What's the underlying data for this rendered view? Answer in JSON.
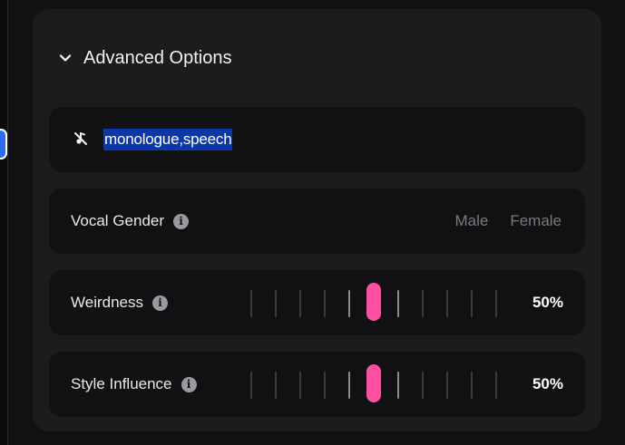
{
  "advanced": {
    "header_label": "Advanced Options",
    "chevron_icon": "chevron-down-icon"
  },
  "exclude": {
    "icon": "music-off-icon",
    "value": "monologue,speech"
  },
  "vocal_gender": {
    "label": "Vocal Gender",
    "options": [
      "Male",
      "Female"
    ]
  },
  "weirdness": {
    "label": "Weirdness",
    "value_text": "50%",
    "value": 0.5
  },
  "style_influence": {
    "label": "Style Influence",
    "value_text": "50%",
    "value": 0.5
  },
  "colors": {
    "accent": "#ff4fa3",
    "selection": "#0b37a8"
  }
}
